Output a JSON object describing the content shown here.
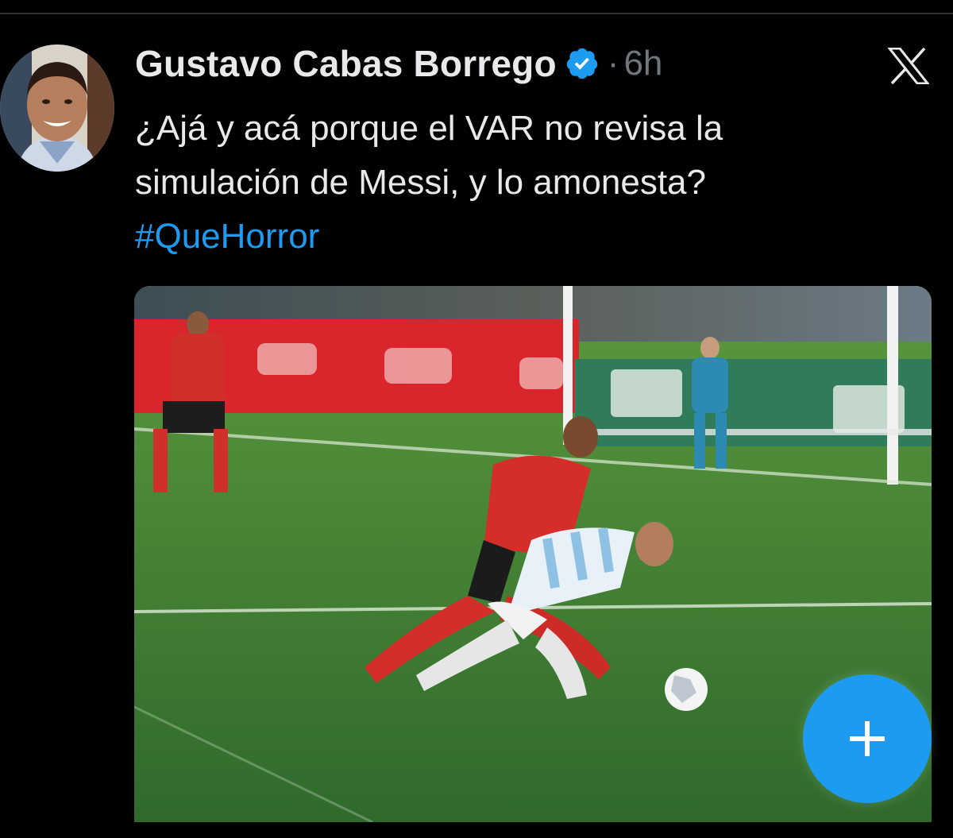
{
  "tweet": {
    "author_name": "Gustavo Cabas Borrego",
    "separator": "·",
    "time": "6h",
    "text_line_1": "¿Ajá y acá porque el VAR no revisa la",
    "text_line_2": "simulación de Messi, y lo amonesta?",
    "hashtag": "#QueHorror"
  },
  "icons": {
    "verified": "verified-badge-icon",
    "x_logo": "x-logo-icon",
    "compose": "plus-icon"
  },
  "colors": {
    "background": "#000000",
    "text": "#e7e9ea",
    "muted": "#71767b",
    "accent": "#1d9bf0"
  }
}
